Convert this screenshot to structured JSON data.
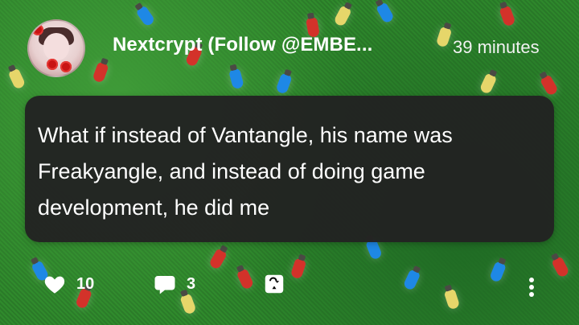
{
  "post": {
    "author": "Nextcrypt (Follow @EMBE...",
    "timestamp": "39 minutes",
    "text": "What if instead of Vantangle, his name was Freakyangle, and instead of doing game development, he did me"
  },
  "actions": {
    "likes": "10",
    "comments": "3",
    "like_icon": "heart-icon",
    "comment_icon": "comment-icon",
    "share_icon": "share-icon",
    "more_icon": "more-vertical-icon"
  },
  "colors": {
    "background": "#2e7d32",
    "bubble": "#222222",
    "text": "#ffffff",
    "light_red": "#d3322a",
    "light_blue": "#1e88e5",
    "light_yellow": "#e6d66a"
  }
}
